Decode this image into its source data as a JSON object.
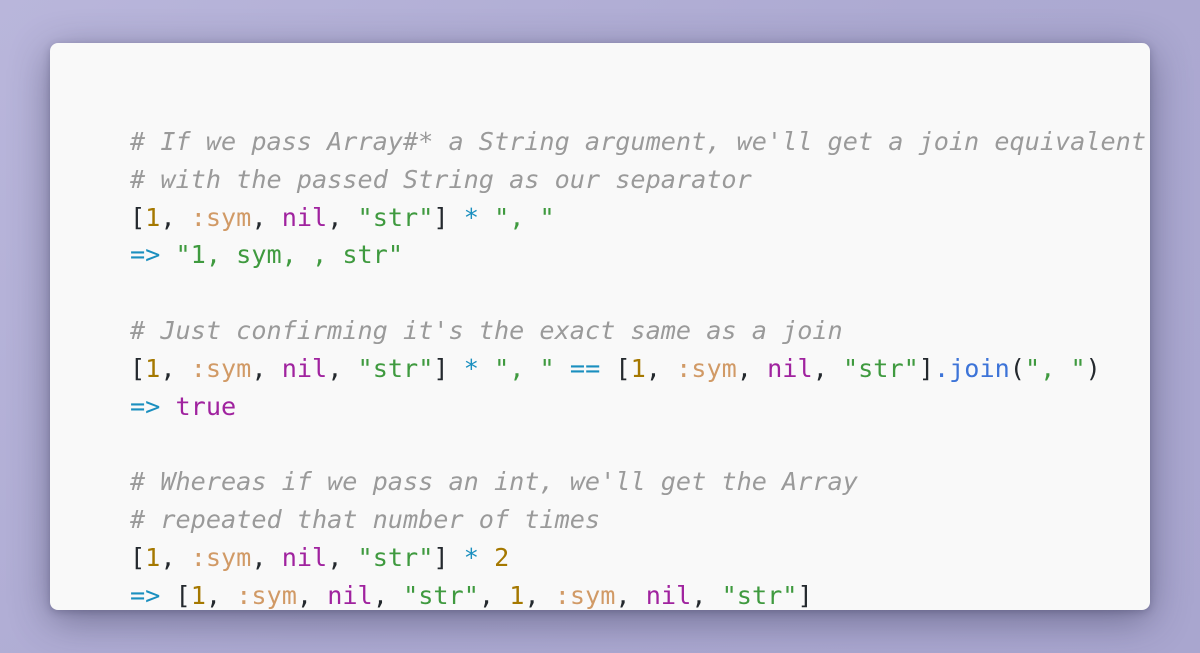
{
  "colors": {
    "background": "#b3b0d6",
    "card": "#f9f9f9",
    "comment": "#9a9a9a",
    "number": "#a57800",
    "symbol": "#d19a66",
    "keyword": "#a0239f",
    "string": "#3f9a3f",
    "operator": "#1a8fbf",
    "method": "#3d74d8",
    "punctuation": "#24292e"
  },
  "code_lines": [
    [
      {
        "t": "c",
        "v": "# If we pass Array#* a String argument, we'll get a join equivalent"
      }
    ],
    [
      {
        "t": "c",
        "v": "# with the passed String as our separator"
      }
    ],
    [
      {
        "t": "pn",
        "v": "["
      },
      {
        "t": "num",
        "v": "1"
      },
      {
        "t": "pn",
        "v": ", "
      },
      {
        "t": "sym",
        "v": ":sym"
      },
      {
        "t": "pn",
        "v": ", "
      },
      {
        "t": "kw",
        "v": "nil"
      },
      {
        "t": "pn",
        "v": ", "
      },
      {
        "t": "str",
        "v": "\"str\""
      },
      {
        "t": "pn",
        "v": "] "
      },
      {
        "t": "op",
        "v": "*"
      },
      {
        "t": "pn",
        "v": " "
      },
      {
        "t": "str",
        "v": "\", \""
      }
    ],
    [
      {
        "t": "op",
        "v": "=>"
      },
      {
        "t": "pn",
        "v": " "
      },
      {
        "t": "str",
        "v": "\"1, sym, , str\""
      }
    ],
    [],
    [
      {
        "t": "c",
        "v": "# Just confirming it's the exact same as a join"
      }
    ],
    [
      {
        "t": "pn",
        "v": "["
      },
      {
        "t": "num",
        "v": "1"
      },
      {
        "t": "pn",
        "v": ", "
      },
      {
        "t": "sym",
        "v": ":sym"
      },
      {
        "t": "pn",
        "v": ", "
      },
      {
        "t": "kw",
        "v": "nil"
      },
      {
        "t": "pn",
        "v": ", "
      },
      {
        "t": "str",
        "v": "\"str\""
      },
      {
        "t": "pn",
        "v": "] "
      },
      {
        "t": "op",
        "v": "*"
      },
      {
        "t": "pn",
        "v": " "
      },
      {
        "t": "str",
        "v": "\", \""
      },
      {
        "t": "pn",
        "v": " "
      },
      {
        "t": "op",
        "v": "=="
      },
      {
        "t": "pn",
        "v": " ["
      },
      {
        "t": "num",
        "v": "1"
      },
      {
        "t": "pn",
        "v": ", "
      },
      {
        "t": "sym",
        "v": ":sym"
      },
      {
        "t": "pn",
        "v": ", "
      },
      {
        "t": "kw",
        "v": "nil"
      },
      {
        "t": "pn",
        "v": ", "
      },
      {
        "t": "str",
        "v": "\"str\""
      },
      {
        "t": "pn",
        "v": "]"
      },
      {
        "t": "meth",
        "v": ".join"
      },
      {
        "t": "pn",
        "v": "("
      },
      {
        "t": "str",
        "v": "\", \""
      },
      {
        "t": "pn",
        "v": ")"
      }
    ],
    [
      {
        "t": "op",
        "v": "=>"
      },
      {
        "t": "pn",
        "v": " "
      },
      {
        "t": "kw",
        "v": "true"
      }
    ],
    [],
    [
      {
        "t": "c",
        "v": "# Whereas if we pass an int, we'll get the Array"
      }
    ],
    [
      {
        "t": "c",
        "v": "# repeated that number of times"
      }
    ],
    [
      {
        "t": "pn",
        "v": "["
      },
      {
        "t": "num",
        "v": "1"
      },
      {
        "t": "pn",
        "v": ", "
      },
      {
        "t": "sym",
        "v": ":sym"
      },
      {
        "t": "pn",
        "v": ", "
      },
      {
        "t": "kw",
        "v": "nil"
      },
      {
        "t": "pn",
        "v": ", "
      },
      {
        "t": "str",
        "v": "\"str\""
      },
      {
        "t": "pn",
        "v": "] "
      },
      {
        "t": "op",
        "v": "*"
      },
      {
        "t": "pn",
        "v": " "
      },
      {
        "t": "num",
        "v": "2"
      }
    ],
    [
      {
        "t": "op",
        "v": "=>"
      },
      {
        "t": "pn",
        "v": " ["
      },
      {
        "t": "num",
        "v": "1"
      },
      {
        "t": "pn",
        "v": ", "
      },
      {
        "t": "sym",
        "v": ":sym"
      },
      {
        "t": "pn",
        "v": ", "
      },
      {
        "t": "kw",
        "v": "nil"
      },
      {
        "t": "pn",
        "v": ", "
      },
      {
        "t": "str",
        "v": "\"str\""
      },
      {
        "t": "pn",
        "v": ", "
      },
      {
        "t": "num",
        "v": "1"
      },
      {
        "t": "pn",
        "v": ", "
      },
      {
        "t": "sym",
        "v": ":sym"
      },
      {
        "t": "pn",
        "v": ", "
      },
      {
        "t": "kw",
        "v": "nil"
      },
      {
        "t": "pn",
        "v": ", "
      },
      {
        "t": "str",
        "v": "\"str\""
      },
      {
        "t": "pn",
        "v": "]"
      }
    ]
  ]
}
